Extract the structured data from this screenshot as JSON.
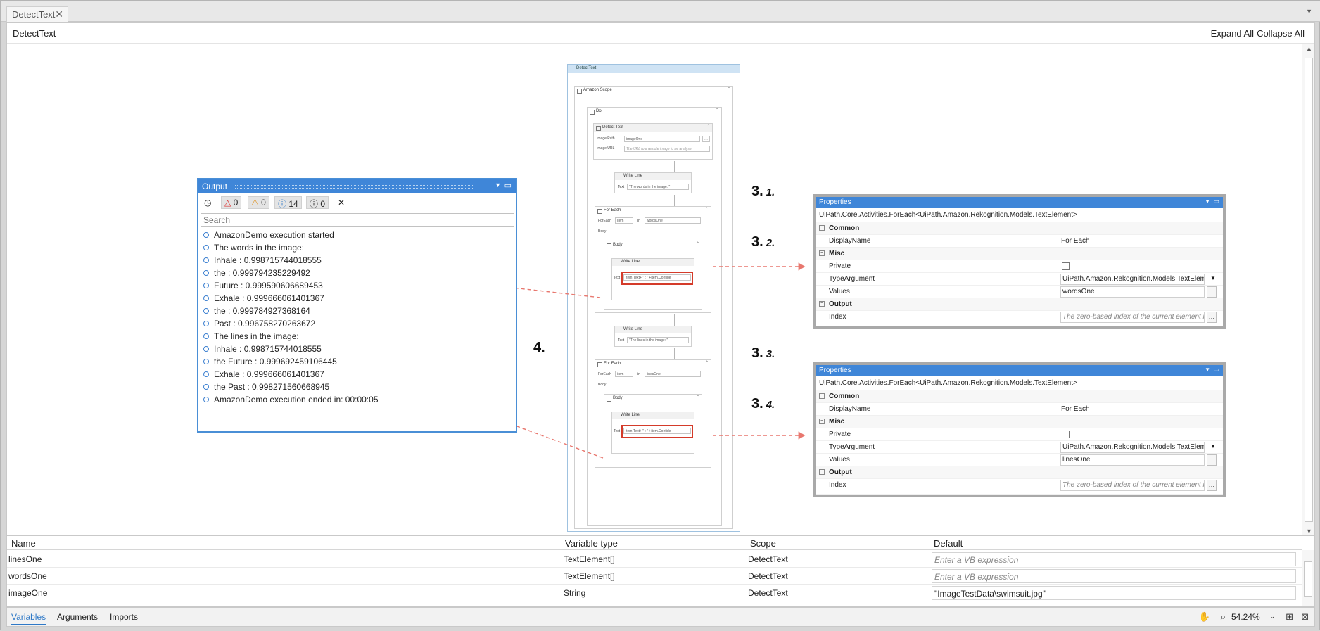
{
  "tab": {
    "label": "DetectText"
  },
  "designer": {
    "breadcrumb": "DetectText",
    "expand_all": "Expand All",
    "collapse_all": "Collapse All"
  },
  "workflow": {
    "root": "DetectText",
    "scope": "Amazon Scope",
    "do": "Do",
    "detect_text": {
      "title": "Detect Text",
      "image_path_label": "Image Path",
      "image_path_value": "imageOne",
      "image_url_label": "Image URL",
      "image_url_placeholder": "The URL to a remote image to be analyse"
    },
    "write_line_1": {
      "title": "Write Line",
      "text_label": "Text",
      "text_value": "\"The words in the image: \""
    },
    "foreach_1": {
      "title": "For Each",
      "foreach_label": "ForEach",
      "item": "item",
      "in_label": "in",
      "collection": "wordsOne",
      "body": "Body",
      "body_seq": "Body",
      "write_line": "Write Line",
      "text_label": "Text",
      "text_value": "item.Text+ \" : \" +item.Confide"
    },
    "write_line_2": {
      "title": "Write Line",
      "text_label": "Text",
      "text_value": "\"The lines in the image: \""
    },
    "foreach_2": {
      "title": "For Each",
      "foreach_label": "ForEach",
      "item": "item",
      "in_label": "in",
      "collection": "linesOne",
      "body": "Body",
      "body_seq": "Body",
      "write_line": "Write Line",
      "text_label": "Text",
      "text_value": "item.Text+ \" : \" +item.Confide"
    }
  },
  "output": {
    "title": "Output",
    "counts": {
      "errors": "0",
      "warnings": "0",
      "info": "14",
      "trace": "0"
    },
    "search_placeholder": "Search",
    "lines": [
      "AmazonDemo execution started",
      "The words in the image:",
      "Inhale : 0.998715744018555",
      "the : 0.999794235229492",
      "Future : 0.999590606689453",
      "Exhale : 0.999666061401367",
      "the : 0.999784927368164",
      "Past : 0.996758270263672",
      "The lines in the image:",
      "Inhale : 0.998715744018555",
      "the Future : 0.999692459106445",
      "Exhale : 0.999666061401367",
      "the Past : 0.998271560668945",
      "AmazonDemo execution ended in: 00:00:05"
    ]
  },
  "steps": {
    "s1": {
      "num": "3.",
      "sub": "1."
    },
    "s2": {
      "num": "3.",
      "sub": "2."
    },
    "s3": {
      "num": "3.",
      "sub": "3."
    },
    "s4": {
      "num": "3.",
      "sub": "4."
    },
    "s5": {
      "num": "4."
    }
  },
  "properties": [
    {
      "title": "Properties",
      "type": "UiPath.Core.Activities.ForEach<UiPath.Amazon.Rekognition.Models.TextElement>",
      "cat_common": "Common",
      "display_name_label": "DisplayName",
      "display_name": "For Each",
      "cat_misc": "Misc",
      "private_label": "Private",
      "type_argument_label": "TypeArgument",
      "type_argument": "UiPath.Amazon.Rekognition.Models.TextElement",
      "values_label": "Values",
      "values": "wordsOne",
      "cat_output": "Output",
      "index_label": "Index",
      "index_placeholder": "The zero-based index of the current element in"
    },
    {
      "title": "Properties",
      "type": "UiPath.Core.Activities.ForEach<UiPath.Amazon.Rekognition.Models.TextElement>",
      "cat_common": "Common",
      "display_name_label": "DisplayName",
      "display_name": "For Each",
      "cat_misc": "Misc",
      "private_label": "Private",
      "type_argument_label": "TypeArgument",
      "type_argument": "UiPath.Amazon.Rekognition.Models.TextElement",
      "values_label": "Values",
      "values": "linesOne",
      "cat_output": "Output",
      "index_label": "Index",
      "index_placeholder": "The zero-based index of the current element in"
    }
  ],
  "variables": {
    "headers": {
      "name": "Name",
      "type": "Variable type",
      "scope": "Scope",
      "default": "Default"
    },
    "rows": [
      {
        "name": "linesOne",
        "type": "TextElement[]",
        "scope": "DetectText",
        "default": "Enter a VB expression"
      },
      {
        "name": "wordsOne",
        "type": "TextElement[]",
        "scope": "DetectText",
        "default": "Enter a VB expression"
      },
      {
        "name": "imageOne",
        "type": "String",
        "scope": "DetectText",
        "default": "\"ImageTestData\\swimsuit.jpg\""
      }
    ]
  },
  "bottom": {
    "tabs": [
      "Variables",
      "Arguments",
      "Imports"
    ],
    "zoom": "54.24%"
  },
  "colors": {
    "accent": "#3f86d8",
    "highlight": "#d43b2a",
    "arrow": "#e8776e"
  }
}
